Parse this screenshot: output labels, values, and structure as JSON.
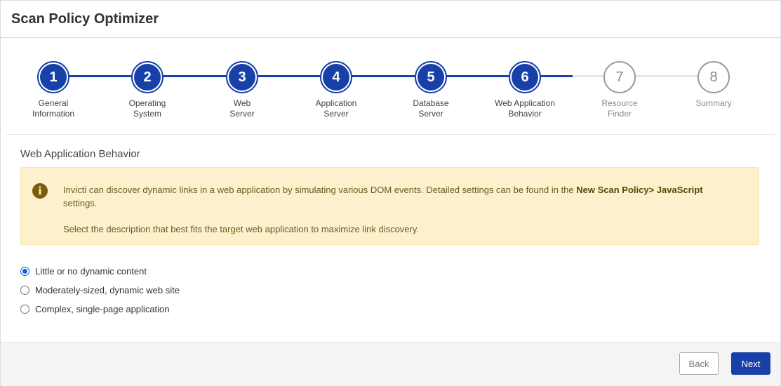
{
  "app": {
    "title": "Scan Policy Optimizer"
  },
  "colors": {
    "accent": "#1740a8",
    "alert_bg": "#fdf1cd",
    "pending": "#9a9a9a"
  },
  "stepper": {
    "current_step": 6,
    "steps": [
      {
        "number": "1",
        "label_line1": "General",
        "label_line2": "Information",
        "state": "done"
      },
      {
        "number": "2",
        "label_line1": "Operating",
        "label_line2": "System",
        "state": "done"
      },
      {
        "number": "3",
        "label_line1": "Web",
        "label_line2": "Server",
        "state": "done"
      },
      {
        "number": "4",
        "label_line1": "Application",
        "label_line2": "Server",
        "state": "done"
      },
      {
        "number": "5",
        "label_line1": "Database",
        "label_line2": "Server",
        "state": "done"
      },
      {
        "number": "6",
        "label_line1": "Web Application",
        "label_line2": "Behavior",
        "state": "current"
      },
      {
        "number": "7",
        "label_line1": "Resource",
        "label_line2": "Finder",
        "state": "todo"
      },
      {
        "number": "8",
        "label_line1": "Summary",
        "label_line2": "",
        "state": "todo"
      }
    ]
  },
  "section": {
    "title": "Web Application Behavior"
  },
  "alert": {
    "icon": "info-icon",
    "text_before": "Invicti can discover dynamic links in a web application by simulating various DOM events. Detailed settings can be found in the ",
    "text_bold": "New Scan Policy> JavaScript",
    "text_after": " settings.",
    "text_second": "Select the description that best fits the target web application to maximize link discovery."
  },
  "options": [
    {
      "label": "Little or no dynamic content",
      "checked": true
    },
    {
      "label": "Moderately-sized, dynamic web site",
      "checked": false
    },
    {
      "label": "Complex, single-page application",
      "checked": false
    }
  ],
  "footer": {
    "back_label": "Back",
    "next_label": "Next"
  }
}
